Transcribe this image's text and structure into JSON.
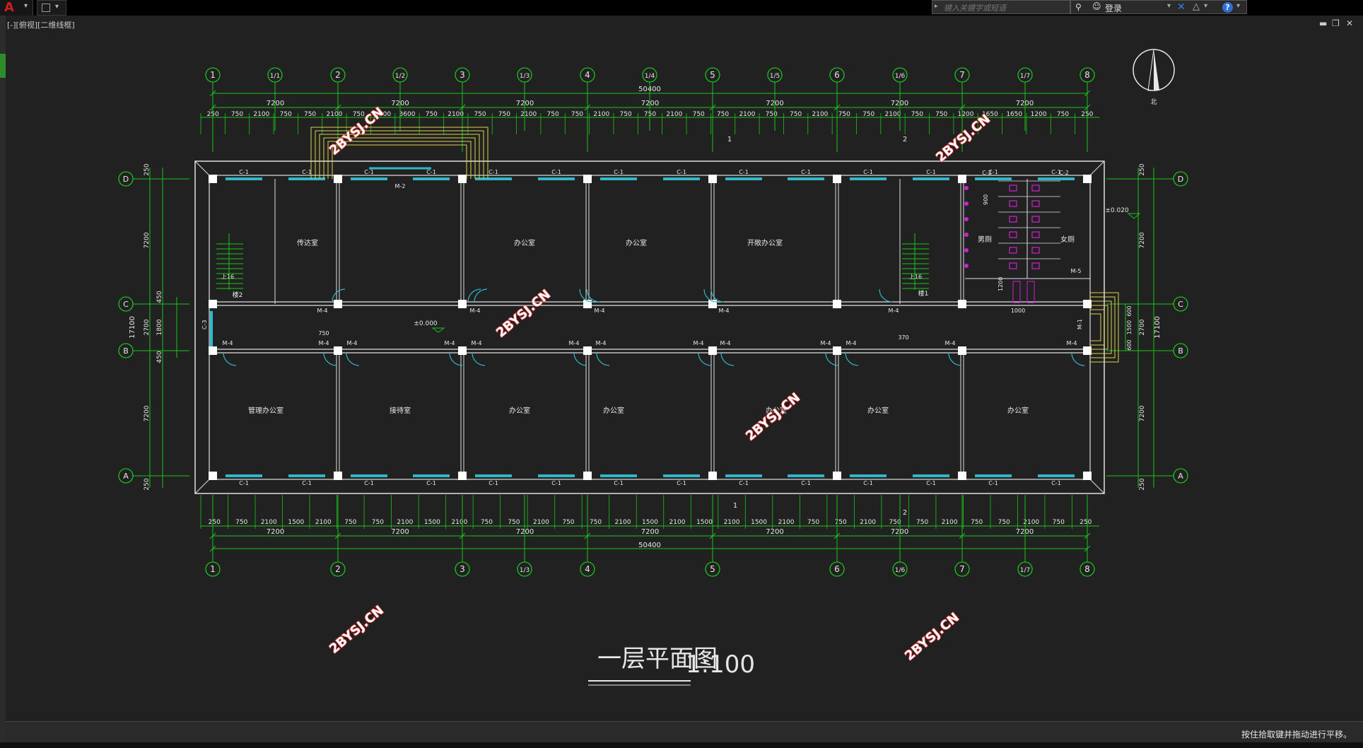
{
  "app": {
    "logo_glyph": "A",
    "viewport_label": "[-][俯视][二维线框]",
    "search_placeholder": "键入关键字或短语",
    "login_label": "登录",
    "help_glyph": "?",
    "status_text": "按住拾取键并拖动进行平移。",
    "win_minimize": "▬",
    "win_restore": "❐",
    "win_close": "✕"
  },
  "drawing": {
    "title": "一层平面图",
    "scale": "1:100",
    "watermark": "2BYSJ.CN",
    "north_label": "北",
    "top_axes": [
      "1",
      "1/1",
      "2",
      "1/2",
      "3",
      "1/3",
      "4",
      "1/4",
      "5",
      "1/5",
      "6",
      "1/6",
      "7",
      "1/7",
      "8"
    ],
    "bottom_axes": [
      "1",
      "2",
      "3",
      "1/3",
      "4",
      "5",
      "6",
      "1/6",
      "7",
      "1/7",
      "8"
    ],
    "row_axes": [
      "D",
      "C",
      "B",
      "A"
    ],
    "total_dim": "50400",
    "bay_dim": "7200",
    "top_detail_dims": [
      "250",
      "750",
      "2100",
      "750",
      "750",
      "2100",
      "750",
      "3600",
      "3600",
      "750",
      "2100",
      "750",
      "750",
      "2100",
      "750",
      "750",
      "2100",
      "750",
      "750",
      "2100",
      "750",
      "750",
      "2100",
      "750",
      "750",
      "2100",
      "750",
      "750",
      "2100",
      "750",
      "750",
      "1200",
      "1650",
      "1650",
      "1200",
      "750",
      "250"
    ],
    "bottom_detail_dims": [
      "250",
      "750",
      "2100",
      "1500",
      "2100",
      "750",
      "750",
      "2100",
      "1500",
      "2100",
      "750",
      "750",
      "2100",
      "750",
      "750",
      "2100",
      "1500",
      "2100",
      "1500",
      "2100",
      "1500",
      "2100",
      "750",
      "750",
      "2100",
      "750",
      "750",
      "2100",
      "750",
      "750",
      "2100",
      "750",
      "250"
    ],
    "left_dims": [
      "250",
      "7200",
      "450",
      "1800",
      "2700",
      "450",
      "7200",
      "250",
      "17100"
    ],
    "right_dims": [
      "250",
      "7200",
      "2700",
      "1500",
      "600",
      "600",
      "17100",
      "7200",
      "250"
    ],
    "level_0": "±0.000",
    "level_right": "±0.020",
    "rooms_north": [
      "传达室",
      "办公室",
      "办公室",
      "开敞办公室"
    ],
    "rooms_south": [
      "管理办公室",
      "接待室",
      "办公室",
      "办公室",
      "办公室",
      "办公室",
      "办公室"
    ],
    "toilet_men": "男厕",
    "toilet_women": "女厕",
    "stair_left": "楼2",
    "stair_right": "楼1",
    "stair_up": "上16",
    "window_c1": "C-1",
    "window_c2": "C-2",
    "window_c3": "C-3",
    "door_m2": "M-2",
    "door_m4": "M-4",
    "door_m5": "M-5",
    "door_m1": "M-1",
    "section_1": "1",
    "section_2": "2",
    "note_750": "750",
    "note_370": "370",
    "note_900": "900",
    "note_1200": "1200",
    "note_1000": "1000"
  }
}
